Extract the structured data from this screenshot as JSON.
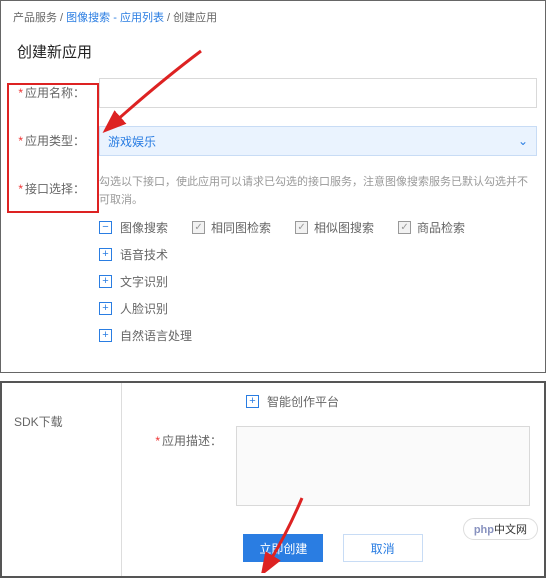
{
  "breadcrumb": {
    "a": "产品服务",
    "b": "图像搜索 - 应用列表",
    "c": "创建应用"
  },
  "title": "创建新应用",
  "form": {
    "name_label": "应用名称：",
    "name_value": "",
    "type_label": "应用类型：",
    "type_value": "游戏娱乐",
    "iface_label": "接口选择：",
    "iface_hint": "勾选以下接口，使此应用可以请求已勾选的接口服务，注意图像搜索服务已默认勾选并不可取消。"
  },
  "checks": {
    "c1": "图像搜索",
    "c2": "相同图检索",
    "c3": "相似图搜索",
    "c4": "商品检索"
  },
  "tree": {
    "t1": "语音技术",
    "t2": "文字识别",
    "t3": "人脸识别",
    "t4": "自然语言处理",
    "t5": "智能创作平台"
  },
  "sdk_label": "SDK下载",
  "desc_label": "应用描述：",
  "desc_value": "",
  "btn_primary": "立即创建",
  "btn_cancel": "取消",
  "logo_p": "php",
  "logo_cn": "中文网"
}
